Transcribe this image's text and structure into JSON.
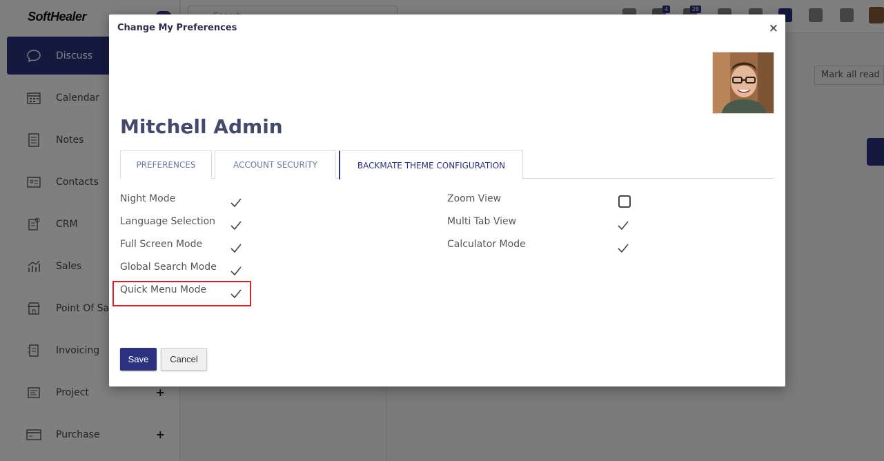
{
  "app": {
    "brand": "SoftHealer",
    "search_placeholder": "Search...",
    "mark_all_read": "Mark all read",
    "badges": {
      "chat": "4",
      "activity": "28"
    }
  },
  "sidebar": {
    "items": [
      {
        "label": "Discuss",
        "icon": "chat-icon",
        "active": true
      },
      {
        "label": "Calendar",
        "icon": "calendar-icon"
      },
      {
        "label": "Notes",
        "icon": "notes-icon"
      },
      {
        "label": "Contacts",
        "icon": "contacts-icon"
      },
      {
        "label": "CRM",
        "icon": "crm-icon"
      },
      {
        "label": "Sales",
        "icon": "sales-chart-icon"
      },
      {
        "label": "Point Of Sale",
        "icon": "store-icon"
      },
      {
        "label": "Invoicing",
        "icon": "invoice-icon"
      },
      {
        "label": "Project",
        "icon": "project-icon",
        "expand": "+"
      },
      {
        "label": "Purchase",
        "icon": "purchase-icon",
        "expand": "+"
      }
    ]
  },
  "modal": {
    "title": "Change My Preferences",
    "close": "×",
    "user_name": "Mitchell Admin",
    "tabs": [
      {
        "label": "PREFERENCES"
      },
      {
        "label": "ACCOUNT SECURITY"
      },
      {
        "label": "BACKMATE THEME CONFIGURATION",
        "active": true
      }
    ],
    "left_fields": [
      {
        "label": "Night Mode",
        "checked": true
      },
      {
        "label": "Language Selection",
        "checked": true
      },
      {
        "label": "Full Screen Mode",
        "checked": true
      },
      {
        "label": "Global Search Mode",
        "checked": true
      },
      {
        "label": "Quick Menu Mode",
        "checked": true
      }
    ],
    "right_fields": [
      {
        "label": "Zoom View",
        "checked": false
      },
      {
        "label": "Multi Tab View",
        "checked": true
      },
      {
        "label": "Calculator Mode",
        "checked": true
      }
    ],
    "save_label": "Save",
    "cancel_label": "Cancel"
  },
  "colors": {
    "primary": "#2b3380",
    "highlight": "#e02020"
  }
}
